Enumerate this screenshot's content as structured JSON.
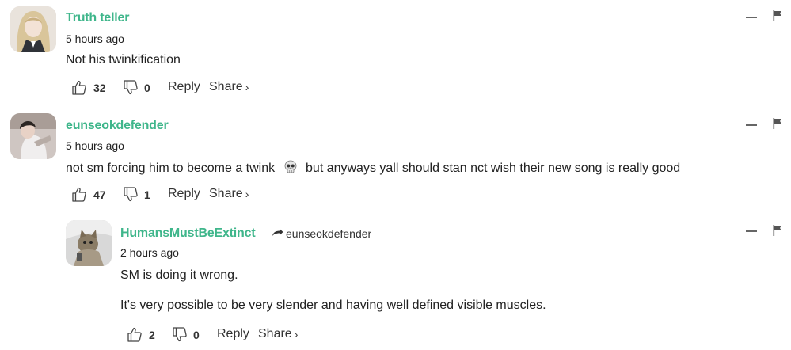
{
  "comments": [
    {
      "username": "Truth teller",
      "time": "5 hours ago",
      "lines": [
        "Not his twinkification"
      ],
      "likes": "32",
      "dislikes": "0",
      "reply_label": "Reply",
      "share_label": "Share",
      "share_chevron": "›"
    },
    {
      "username": "eunseokdefender",
      "time": "5 hours ago",
      "text_before_emoji": "not sm forcing him to become a twink",
      "emoji": "skull",
      "text_after_emoji": "but anyways yall should stan nct wish their new song is really good",
      "likes": "47",
      "dislikes": "1",
      "reply_label": "Reply",
      "share_label": "Share",
      "share_chevron": "›"
    },
    {
      "username": "HumansMustBeExtinct",
      "reply_to": "eunseokdefender",
      "time": "2 hours ago",
      "lines": [
        "SM is doing it wrong.",
        "It's very possible to be very slender and having well defined visible muscles."
      ],
      "likes": "2",
      "dislikes": "0",
      "reply_label": "Reply",
      "share_label": "Share",
      "share_chevron": "›"
    }
  ],
  "icons": {
    "like": "thumbs-up-icon",
    "dislike": "thumbs-down-icon",
    "collapse": "minus-icon",
    "flag": "flag-icon",
    "reply_arrow": "reply-arrow-icon"
  },
  "colors": {
    "username": "#3fb68b",
    "text": "#222222",
    "muted": "#666666"
  }
}
